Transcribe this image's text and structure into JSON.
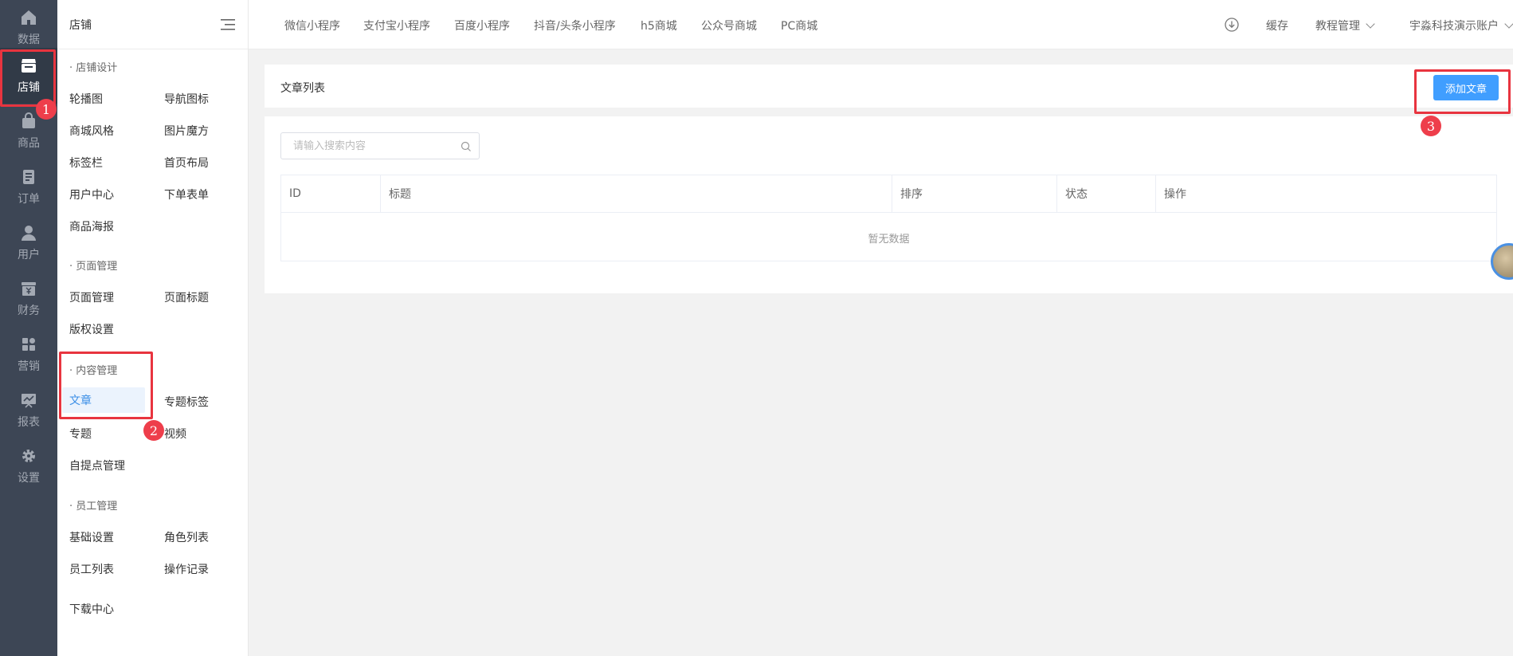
{
  "main_nav": {
    "items": [
      {
        "label": "数据",
        "icon": "home-icon"
      },
      {
        "label": "店铺",
        "icon": "store-icon",
        "active": true
      },
      {
        "label": "商品",
        "icon": "shopping-bag-icon"
      },
      {
        "label": "订单",
        "icon": "order-icon"
      },
      {
        "label": "用户",
        "icon": "user-icon"
      },
      {
        "label": "财务",
        "icon": "finance-icon"
      },
      {
        "label": "营销",
        "icon": "apps-icon"
      },
      {
        "label": "报表",
        "icon": "report-icon"
      },
      {
        "label": "设置",
        "icon": "gear-icon"
      }
    ]
  },
  "sub_nav": {
    "title": "店铺",
    "groups": [
      {
        "title": "· 店铺设计",
        "links": [
          "轮播图",
          "导航图标",
          "商城风格",
          "图片魔方",
          "标签栏",
          "首页布局",
          "用户中心",
          "下单表单",
          "商品海报"
        ]
      },
      {
        "title": "· 页面管理",
        "links": [
          "页面管理",
          "页面标题",
          "版权设置"
        ]
      },
      {
        "title": "· 内容管理",
        "links": [
          "文章",
          "专题标签",
          "专题",
          "视频",
          "自提点管理"
        ]
      },
      {
        "title": "· 员工管理",
        "links": [
          "基础设置",
          "角色列表",
          "员工列表",
          "操作记录"
        ]
      }
    ],
    "download_center": "下载中心"
  },
  "top_tabs": [
    "微信小程序",
    "支付宝小程序",
    "百度小程序",
    "抖音/头条小程序",
    "h5商城",
    "公众号商城",
    "PC商城"
  ],
  "top_right": {
    "cache": "缓存",
    "tutorial": "教程管理",
    "account": "宇淼科技演示账户"
  },
  "page": {
    "title": "文章列表",
    "add_button": "添加文章",
    "search_placeholder": "请输入搜索内容",
    "table_headers": [
      "ID",
      "标题",
      "排序",
      "状态",
      "操作"
    ],
    "empty_text": "暂无数据"
  },
  "annotations": [
    "1",
    "2",
    "3"
  ],
  "colors": {
    "sidebar_bg": "#3d4655",
    "sidebar_active_bg": "#313a47",
    "primary": "#409eff",
    "annotation_red": "#e8343f"
  }
}
